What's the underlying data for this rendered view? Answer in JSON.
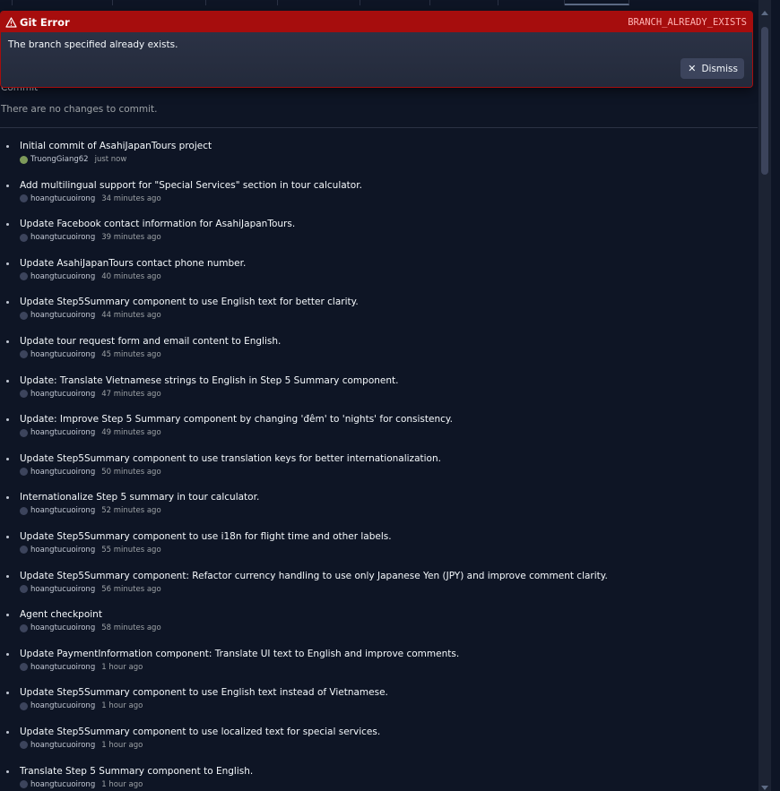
{
  "error": {
    "title": "Git Error",
    "code": "BRANCH_ALREADY_EXISTS",
    "message": "The branch specified already exists.",
    "dismiss_label": "Dismiss"
  },
  "commit_section": {
    "heading": "Commit",
    "empty_text": "There are no changes to commit."
  },
  "history": [
    {
      "message": "Initial commit of AsahiJapanTours project",
      "author": "TruongGiang62",
      "time": "just now"
    },
    {
      "message": "Add multilingual support for \"Special Services\" section in tour calculator.",
      "author": "hoangtucuoirong",
      "time": "34 minutes ago"
    },
    {
      "message": "Update Facebook contact information for AsahiJapanTours.",
      "author": "hoangtucuoirong",
      "time": "39 minutes ago"
    },
    {
      "message": "Update AsahiJapanTours contact phone number.",
      "author": "hoangtucuoirong",
      "time": "40 minutes ago"
    },
    {
      "message": "Update Step5Summary component to use English text for better clarity.",
      "author": "hoangtucuoirong",
      "time": "44 minutes ago"
    },
    {
      "message": "Update tour request form and email content to English.",
      "author": "hoangtucuoirong",
      "time": "45 minutes ago"
    },
    {
      "message": "Update: Translate Vietnamese strings to English in Step 5 Summary component.",
      "author": "hoangtucuoirong",
      "time": "47 minutes ago"
    },
    {
      "message": "Update: Improve Step 5 Summary component by changing 'đêm' to 'nights' for consistency.",
      "author": "hoangtucuoirong",
      "time": "49 minutes ago"
    },
    {
      "message": "Update Step5Summary component to use translation keys for better internationalization.",
      "author": "hoangtucuoirong",
      "time": "50 minutes ago"
    },
    {
      "message": "Internationalize Step 5 summary in tour calculator.",
      "author": "hoangtucuoirong",
      "time": "52 minutes ago"
    },
    {
      "message": "Update Step5Summary component to use i18n for flight time and other labels.",
      "author": "hoangtucuoirong",
      "time": "55 minutes ago"
    },
    {
      "message": "Update Step5Summary component: Refactor currency handling to use only Japanese Yen (JPY) and improve comment clarity.",
      "author": "hoangtucuoirong",
      "time": "56 minutes ago"
    },
    {
      "message": "Agent checkpoint",
      "author": "hoangtucuoirong",
      "time": "58 minutes ago"
    },
    {
      "message": "Update PaymentInformation component: Translate UI text to English and improve comments.",
      "author": "hoangtucuoirong",
      "time": "1 hour ago"
    },
    {
      "message": "Update Step5Summary component to use English text instead of Vietnamese.",
      "author": "hoangtucuoirong",
      "time": "1 hour ago"
    },
    {
      "message": "Update Step5Summary component to use localized text for special services.",
      "author": "hoangtucuoirong",
      "time": "1 hour ago"
    },
    {
      "message": "Translate Step 5 Summary component to English.",
      "author": "hoangtucuoirong",
      "time": "1 hour ago"
    }
  ],
  "colors": {
    "background": "#0e1525",
    "error_red": "#a60d0d",
    "panel": "#2b3245",
    "text": "#f5f9fc",
    "muted": "#9da2a6"
  },
  "icons": {
    "error": "warning-triangle-icon",
    "dismiss": "close-icon",
    "avatar": "avatar-icon"
  }
}
